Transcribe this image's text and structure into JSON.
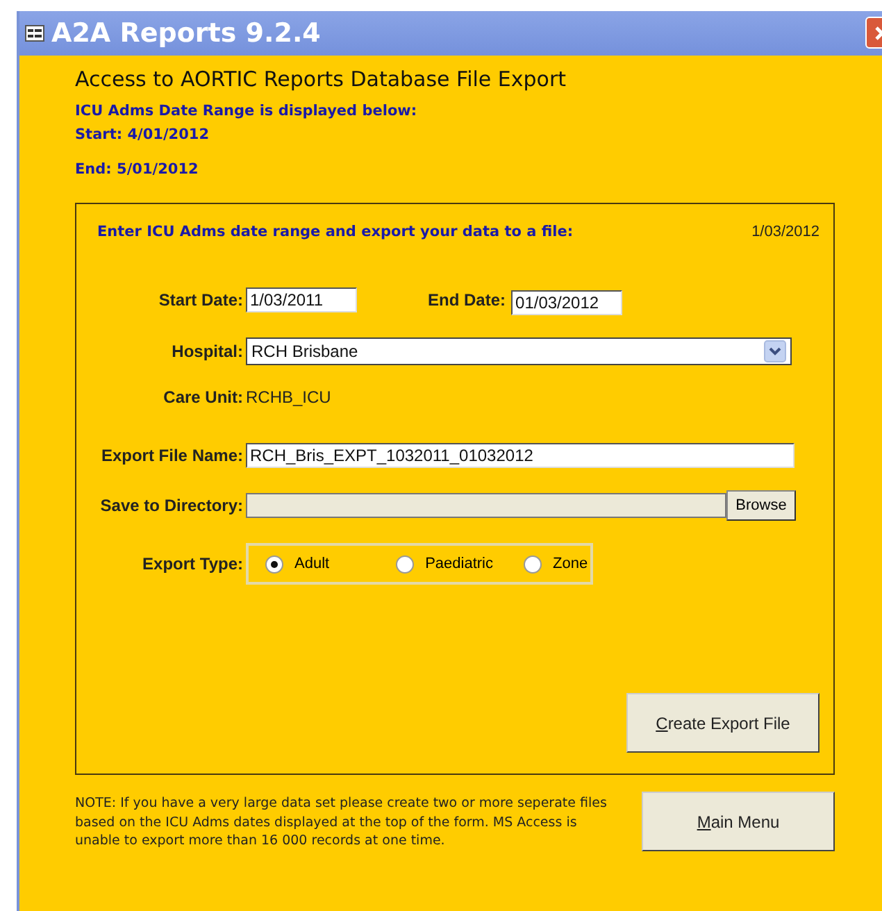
{
  "window": {
    "title": "A2A Reports 9.2.4"
  },
  "header": {
    "title": "Access to AORTIC Reports Database File Export",
    "range_heading": "ICU Adms Date Range is displayed below:",
    "start": "Start:  4/01/2012",
    "end": "End:  5/01/2012"
  },
  "panel": {
    "instruction": "Enter ICU Adms date range and export your data to a file:",
    "today": "1/03/2012",
    "start_date": {
      "label": "Start Date:",
      "value": "1/03/2011"
    },
    "end_date": {
      "label": "End Date:",
      "value": "01/03/2012"
    },
    "hospital": {
      "label": "Hospital:",
      "value": "RCH Brisbane"
    },
    "care_unit": {
      "label": "Care Unit:",
      "value": "RCHB_ICU"
    },
    "export_file_name": {
      "label": "Export File Name:",
      "value": "RCH_Bris_EXPT_1032011_01032012"
    },
    "save_directory": {
      "label": "Save to Directory:",
      "button": "Browse"
    },
    "export_type": {
      "label": "Export Type:",
      "options": [
        {
          "label": "Adult",
          "selected": true
        },
        {
          "label": "Paediatric",
          "selected": false
        },
        {
          "label": "Zone",
          "selected": false
        }
      ]
    },
    "create_button": "Create Export File"
  },
  "note": "NOTE: If you have a very large data set please create two or more seperate files based on the ICU Adms dates displayed at the top of the form. MS Access is unable to export more than 16 000 records at one time.",
  "main_menu_button": "Main Menu"
}
